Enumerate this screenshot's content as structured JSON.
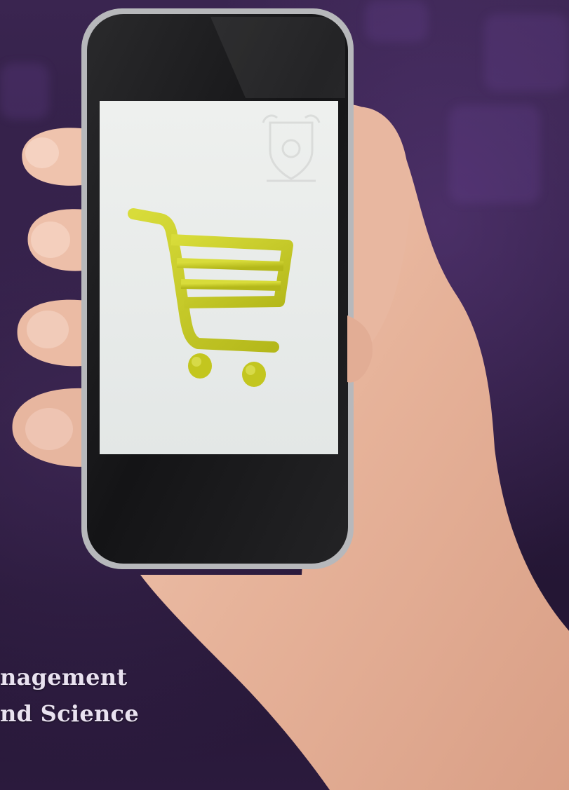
{
  "cover": {
    "text_lines": [
      "nagement",
      "nd Science"
    ]
  },
  "colors": {
    "background": "#2d1c40",
    "cart": "#c9cf1f",
    "phone_screen": "#e9ecea",
    "phone_bezel": "#1b1b1d",
    "phone_frame": "#b9b9bc",
    "skin": "#e9b9a2"
  },
  "icons": {
    "phone_app_icon": "shopping-cart-icon",
    "crest": "university-crest-icon"
  }
}
